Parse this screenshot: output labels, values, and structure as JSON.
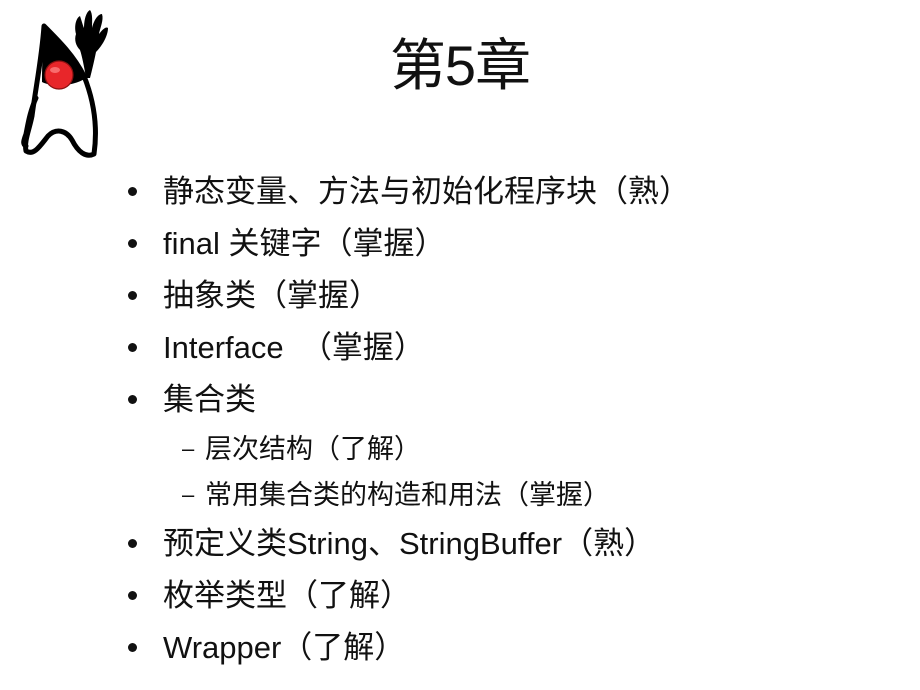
{
  "slide": {
    "logo": "java-duke-mascot",
    "title": "第5章",
    "items": [
      {
        "text": "静态变量、方法与初始化程序块（熟）"
      },
      {
        "text": "final 关键字（掌握）"
      },
      {
        "text": "抽象类（掌握）"
      },
      {
        "text": "Interface  （掌握）"
      },
      {
        "text": "集合类",
        "subitems": [
          {
            "text": "层次结构（了解）"
          },
          {
            "text": "常用集合类的构造和用法（掌握）"
          }
        ]
      },
      {
        "text": "预定义类String、StringBuffer（熟）"
      },
      {
        "text": "枚举类型（了解）"
      },
      {
        "text": "Wrapper（了解）"
      }
    ],
    "sub_marker": "–",
    "colors": {
      "text": "#111111",
      "background": "#ffffff",
      "mascot_nose": "#e8262a",
      "mascot_outline": "#000000"
    }
  }
}
